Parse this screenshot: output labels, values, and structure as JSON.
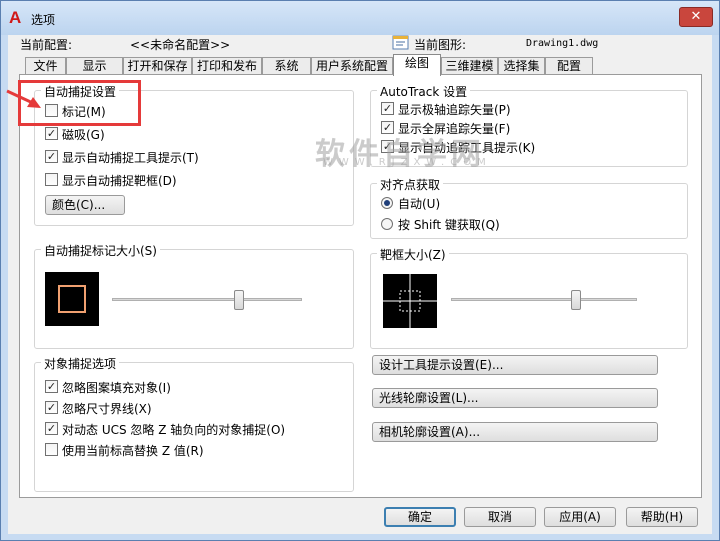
{
  "window": {
    "title": "选项",
    "close_symbol": "✕"
  },
  "header": {
    "current_config_label": "当前配置:",
    "current_config_value": "<<未命名配置>>",
    "current_drawing_label": "当前图形:",
    "current_drawing_value": "Drawing1.dwg"
  },
  "tabs": [
    "文件",
    "显示",
    "打开和保存",
    "打印和发布",
    "系统",
    "用户系统配置",
    "绘图",
    "三维建模",
    "选择集",
    "配置"
  ],
  "active_tab": "绘图",
  "autosnap": {
    "title": "自动捕捉设置",
    "marker": {
      "label": "标记(M)",
      "checked": false
    },
    "magnet": {
      "label": "磁吸(G)",
      "checked": true
    },
    "tooltip": {
      "label": "显示自动捕捉工具提示(T)",
      "checked": true
    },
    "aperture": {
      "label": "显示自动捕捉靶框(D)",
      "checked": false
    },
    "color_button": "颜色(C)..."
  },
  "autotrack": {
    "title": "AutoTrack 设置",
    "polar": {
      "label": "显示极轴追踪矢量(P)",
      "checked": true
    },
    "fullscreen": {
      "label": "显示全屏追踪矢量(F)",
      "checked": true
    },
    "tooltip": {
      "label": "显示自动追踪工具提示(K)",
      "checked": true
    }
  },
  "alignment": {
    "title": "对齐点获取",
    "auto": {
      "label": "自动(U)",
      "selected": true
    },
    "shift": {
      "label": "按 Shift 键获取(Q)",
      "selected": false
    }
  },
  "marker_size": {
    "title": "自动捕捉标记大小(S)",
    "level": 0.67
  },
  "aperture_size": {
    "title": "靶框大小(Z)",
    "level": 0.67
  },
  "object_snap": {
    "title": "对象捕捉选项",
    "hatch": {
      "label": "忽略图案填充对象(I)",
      "checked": true
    },
    "dimension": {
      "label": "忽略尺寸界线(X)",
      "checked": true
    },
    "dynamic_ucs": {
      "label": "对动态 UCS 忽略 Z 轴负向的对象捕捉(O)",
      "checked": true
    },
    "elevation": {
      "label": "使用当前标高替换 Z 值(R)",
      "checked": false
    }
  },
  "side_buttons": {
    "design_tooltip": "设计工具提示设置(E)...",
    "light_glyph": "光线轮廓设置(L)...",
    "camera_glyph": "相机轮廓设置(A)..."
  },
  "footer": {
    "ok": "确定",
    "cancel": "取消",
    "apply": "应用(A)",
    "help": "帮助(H)"
  },
  "watermark": {
    "text": "软件自学网",
    "url": "WWW.RJZXW.COM"
  },
  "colors": {
    "highlight": "#e53a3a",
    "marker_color": "#f0a070",
    "title_accent": "#d01818"
  }
}
